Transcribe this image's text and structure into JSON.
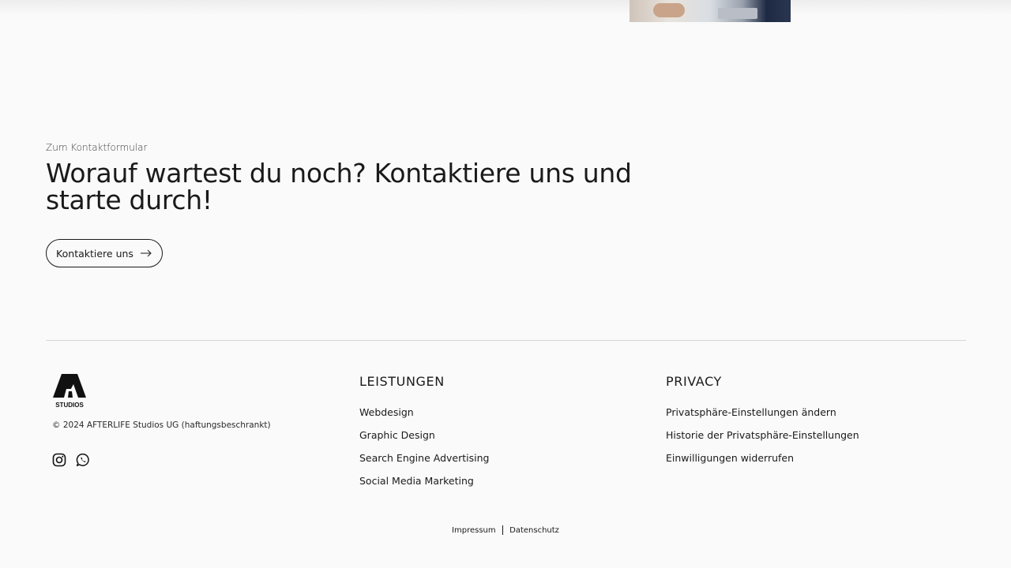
{
  "contact": {
    "eyebrow": "Zum Kontaktformular",
    "headline": "Worauf wartest du noch? Kontaktiere uns und starte durch!",
    "cta_label": "Kontaktiere uns",
    "cta_icon": "arrow-right-icon"
  },
  "footer": {
    "logo_text": "STUDIOS",
    "copyright": "© 2024 AFTERLIFE Studios UG (haftungsbeschrankt)",
    "social": [
      {
        "name": "instagram-icon"
      },
      {
        "name": "whatsapp-icon"
      }
    ],
    "columns": [
      {
        "title": "LEISTUNGEN",
        "items": [
          "Webdesign",
          "Graphic Design",
          "Search Engine Advertising",
          "Social Media Marketing"
        ]
      },
      {
        "title": "PRIVACY",
        "items": [
          "Privatsphäre-Einstellungen ändern",
          "Historie der Privatsphäre-Einstellungen",
          "Einwilligungen widerrufen"
        ]
      }
    ],
    "legal": {
      "impressum": "Impressum",
      "datenschutz": "Datenschutz"
    }
  }
}
